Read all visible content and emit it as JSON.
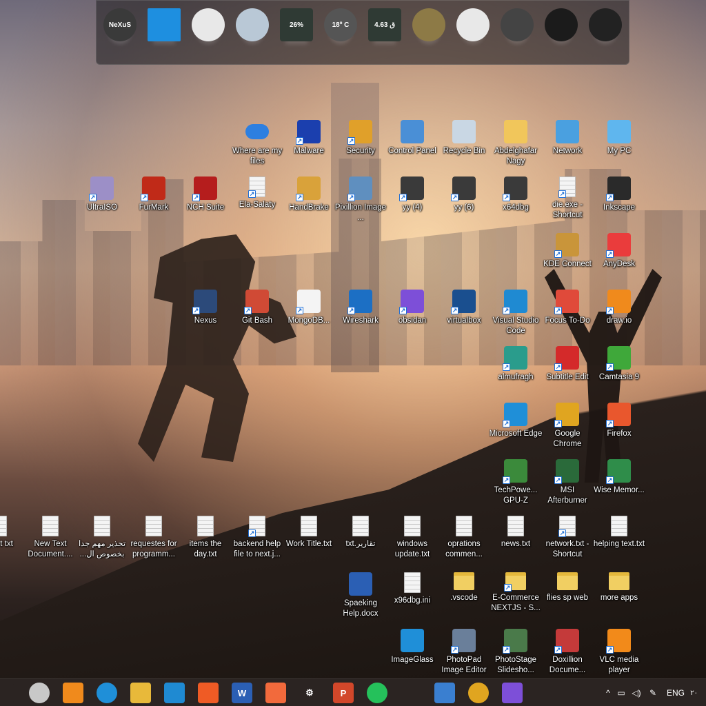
{
  "dock": {
    "items": [
      {
        "name": "nexus-logo",
        "text": "NeXuS",
        "color": "#3a3a3a"
      },
      {
        "name": "windows-start",
        "text": "",
        "color": "#1e8fe0"
      },
      {
        "name": "clock",
        "text": "",
        "color": "#e8e8e8"
      },
      {
        "name": "recycle-bin",
        "text": "",
        "color": "#b9c8d6"
      },
      {
        "name": "cpu-meter",
        "text": "26%",
        "color": "#2f3a34"
      },
      {
        "name": "weather",
        "text": "18º C",
        "color": "#555"
      },
      {
        "name": "network-meter",
        "text": "4.63 ق",
        "color": "#2f3a34"
      },
      {
        "name": "internet-globe",
        "text": "",
        "color": "#8d7a46"
      },
      {
        "name": "mail",
        "text": "",
        "color": "#e8e8e8"
      },
      {
        "name": "power",
        "text": "",
        "color": "#444"
      },
      {
        "name": "speaker",
        "text": "",
        "color": "#1b1b1b"
      },
      {
        "name": "camera",
        "text": "",
        "color": "#222"
      }
    ]
  },
  "desktop_icons": [
    {
      "label": "Where are my files",
      "kind": "cloud",
      "color": "#2d7fe0",
      "shortcut": false
    },
    {
      "label": "Malware",
      "kind": "app",
      "color": "#1b3fae",
      "shortcut": true
    },
    {
      "label": "Security",
      "kind": "app",
      "color": "#e0a02a",
      "shortcut": true
    },
    {
      "label": "Control Panel",
      "kind": "app",
      "color": "#4a8fd6",
      "shortcut": false
    },
    {
      "label": "Recycle Bin",
      "kind": "app",
      "color": "#c9d7e4",
      "shortcut": false
    },
    {
      "label": "Abdelghafar Nagy",
      "kind": "app",
      "color": "#f1c65b",
      "shortcut": false
    },
    {
      "label": "Network",
      "kind": "app",
      "color": "#4aa0e0",
      "shortcut": false
    },
    {
      "label": "My PC",
      "kind": "app",
      "color": "#5fb6ee",
      "shortcut": false
    },
    {
      "label": "UltraISO",
      "kind": "app",
      "color": "#9c8fc7",
      "shortcut": true
    },
    {
      "label": "FurMark",
      "kind": "app",
      "color": "#c02a18",
      "shortcut": true
    },
    {
      "label": "NCH Suite",
      "kind": "app",
      "color": "#b51d1d",
      "shortcut": true
    },
    {
      "label": "Ela-Salaty",
      "kind": "doc",
      "color": "",
      "shortcut": true
    },
    {
      "label": "HandBrake",
      "kind": "app",
      "color": "#d9a23a",
      "shortcut": true
    },
    {
      "label": "Pixillion Image ...",
      "kind": "app",
      "color": "#5f8fbf",
      "shortcut": true
    },
    {
      "label": "yy (4)",
      "kind": "app",
      "color": "#3a3a3a",
      "shortcut": true
    },
    {
      "label": "yy (6)",
      "kind": "app",
      "color": "#3a3a3a",
      "shortcut": true
    },
    {
      "label": "x64dbg",
      "kind": "app",
      "color": "#3a3a3a",
      "shortcut": true
    },
    {
      "label": "die.exe - Shortcut",
      "kind": "doc",
      "color": "",
      "shortcut": true
    },
    {
      "label": "Inkscape",
      "kind": "app",
      "color": "#2a2a2a",
      "shortcut": true
    },
    {
      "label": "KDE Connect",
      "kind": "app",
      "color": "#c9953a",
      "shortcut": true
    },
    {
      "label": "AnyDesk",
      "kind": "app",
      "color": "#ea3c3c",
      "shortcut": true
    },
    {
      "label": "Nexus",
      "kind": "app",
      "color": "#2c4a7a",
      "shortcut": true
    },
    {
      "label": "Git Bash",
      "kind": "app",
      "color": "#d04a35",
      "shortcut": true
    },
    {
      "label": "MongoDB...",
      "kind": "app",
      "color": "#f4f4f4",
      "shortcut": true
    },
    {
      "label": "Wireshark",
      "kind": "app",
      "color": "#1c6fc4",
      "shortcut": true
    },
    {
      "label": "obsidan",
      "kind": "app",
      "color": "#7d4fd8",
      "shortcut": true
    },
    {
      "label": "virtualbox",
      "kind": "app",
      "color": "#1a4f8f",
      "shortcut": true
    },
    {
      "label": "Visual Studio Code",
      "kind": "app",
      "color": "#1f8ad2",
      "shortcut": true
    },
    {
      "label": "Focus To-Do",
      "kind": "app",
      "color": "#e04a3a",
      "shortcut": true
    },
    {
      "label": "draw.io",
      "kind": "app",
      "color": "#f08a1c",
      "shortcut": true
    },
    {
      "label": "almufragh",
      "kind": "app",
      "color": "#2a9c8c",
      "shortcut": true
    },
    {
      "label": "Subtitle Edit",
      "kind": "app",
      "color": "#d42a2a",
      "shortcut": true
    },
    {
      "label": "Camtasia 9",
      "kind": "app",
      "color": "#3fa83a",
      "shortcut": true
    },
    {
      "label": "Microsoft Edge",
      "kind": "app",
      "color": "#1f8fd8",
      "shortcut": true
    },
    {
      "label": "Google Chrome",
      "kind": "app",
      "color": "#e0a520",
      "shortcut": true
    },
    {
      "label": "Firefox",
      "kind": "app",
      "color": "#e9572d",
      "shortcut": true
    },
    {
      "label": "TechPowe... GPU-Z",
      "kind": "app",
      "color": "#3b8a3b",
      "shortcut": true
    },
    {
      "label": "MSI Afterburner",
      "kind": "app",
      "color": "#2a6a3a",
      "shortcut": true
    },
    {
      "label": "Wise Memor...",
      "kind": "app",
      "color": "#2f8d4a",
      "shortcut": true
    },
    {
      "label": "eport txt",
      "kind": "doc",
      "color": "",
      "shortcut": false
    },
    {
      "label": "New Text Document....",
      "kind": "doc",
      "color": "",
      "shortcut": false
    },
    {
      "label": "تحذير مهم جدا بخصوص ال...",
      "kind": "doc",
      "color": "",
      "shortcut": false
    },
    {
      "label": "requestes for programm...",
      "kind": "doc",
      "color": "",
      "shortcut": false
    },
    {
      "label": "items the day.txt",
      "kind": "doc",
      "color": "",
      "shortcut": false
    },
    {
      "label": "backend help file to next.j...",
      "kind": "doc",
      "color": "",
      "shortcut": true
    },
    {
      "label": "Work Title.txt",
      "kind": "doc",
      "color": "",
      "shortcut": false
    },
    {
      "label": "تقارير.txt",
      "kind": "doc",
      "color": "",
      "shortcut": false
    },
    {
      "label": "windows update.txt",
      "kind": "doc",
      "color": "",
      "shortcut": false
    },
    {
      "label": "oprations commen...",
      "kind": "doc",
      "color": "",
      "shortcut": false
    },
    {
      "label": "news.txt",
      "kind": "doc",
      "color": "",
      "shortcut": false
    },
    {
      "label": "network.txt - Shortcut",
      "kind": "doc",
      "color": "",
      "shortcut": true
    },
    {
      "label": "helping text.txt",
      "kind": "doc",
      "color": "",
      "shortcut": false
    },
    {
      "label": "Spaeking Help.docx",
      "kind": "app",
      "color": "#2b5fb4",
      "shortcut": false
    },
    {
      "label": "x96dbg.ini",
      "kind": "doc",
      "color": "",
      "shortcut": false
    },
    {
      "label": ".vscode",
      "kind": "folder",
      "color": "",
      "shortcut": false
    },
    {
      "label": "E-Commerce NEXTJS - S...",
      "kind": "folder",
      "color": "",
      "shortcut": true
    },
    {
      "label": "flies sp web",
      "kind": "folder",
      "color": "",
      "shortcut": false
    },
    {
      "label": "more apps",
      "kind": "folder",
      "color": "",
      "shortcut": false
    },
    {
      "label": "ImageGlass",
      "kind": "app",
      "color": "#1f8fd8",
      "shortcut": false
    },
    {
      "label": "PhotoPad Image Editor",
      "kind": "app",
      "color": "#6a7f9a",
      "shortcut": true
    },
    {
      "label": "PhotoStage Slidesho...",
      "kind": "app",
      "color": "#4a7a4a",
      "shortcut": true
    },
    {
      "label": "Doxillion Docume...",
      "kind": "app",
      "color": "#c43a3a",
      "shortcut": true
    },
    {
      "label": "VLC media player",
      "kind": "app",
      "color": "#f28a1a",
      "shortcut": true
    }
  ],
  "taskbar": {
    "items": [
      {
        "name": "task-view",
        "text": "",
        "color": "#2b2422"
      },
      {
        "name": "clock-app",
        "text": "",
        "color": "#c8c8c8"
      },
      {
        "name": "drawio",
        "text": "",
        "color": "#f08a1c"
      },
      {
        "name": "edge",
        "text": "",
        "color": "#1f8fd8"
      },
      {
        "name": "file-explorer",
        "text": "",
        "color": "#e8b93a"
      },
      {
        "name": "vscode",
        "text": "",
        "color": "#1f8ad2"
      },
      {
        "name": "postman",
        "text": "",
        "color": "#ef5b25"
      },
      {
        "name": "word",
        "text": "W",
        "color": "#2b5fb4"
      },
      {
        "name": "xampp",
        "text": "",
        "color": "#f26a3c"
      },
      {
        "name": "settings",
        "text": "⚙",
        "color": "#2b2422"
      },
      {
        "name": "powerpoint",
        "text": "P",
        "color": "#d2472a"
      },
      {
        "name": "whatsapp",
        "text": "",
        "color": "#25c15b"
      },
      {
        "name": "figma",
        "text": "",
        "color": "#2b2422"
      },
      {
        "name": "store",
        "text": "",
        "color": "#3a7fd0"
      },
      {
        "name": "chrome",
        "text": "",
        "color": "#e0a520"
      },
      {
        "name": "obsidian",
        "text": "",
        "color": "#7d4fd8"
      }
    ],
    "tray": {
      "chevron": "^",
      "language": "ENG",
      "clock_fragment": "٢٠"
    }
  }
}
